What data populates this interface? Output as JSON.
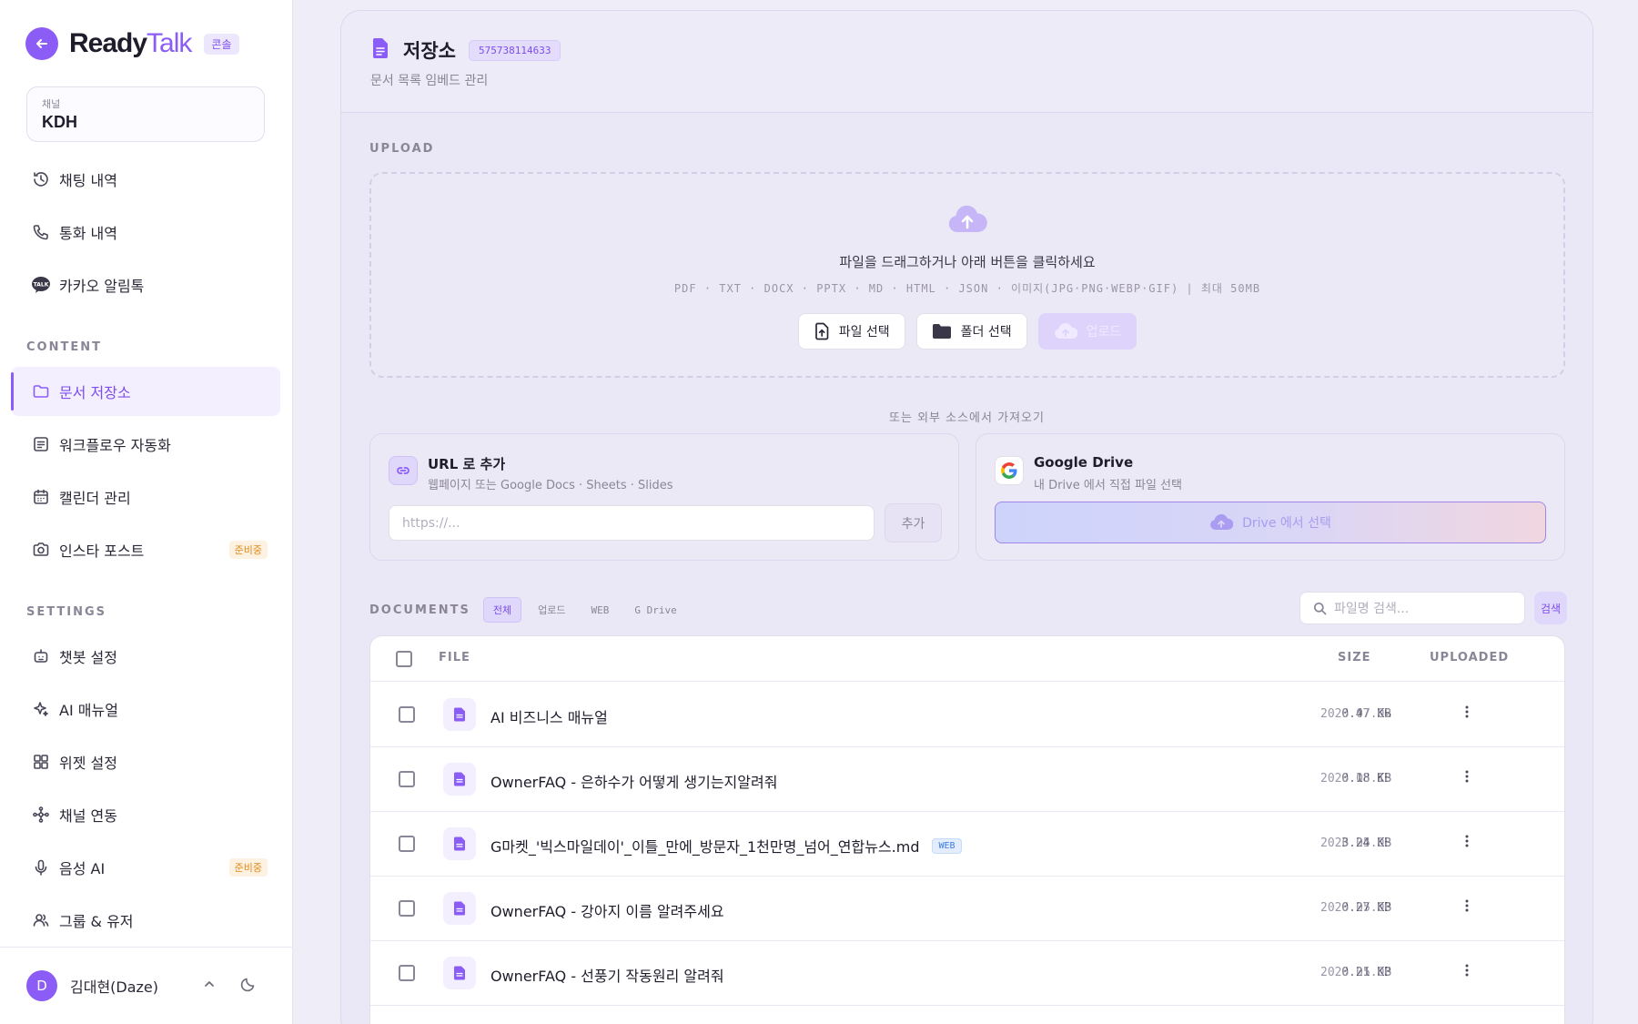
{
  "brand": {
    "logo_part1": "Ready",
    "logo_part2": "Talk",
    "badge": "콘솔"
  },
  "channel": {
    "label": "채널",
    "value": "KDH"
  },
  "nav_top": [
    {
      "label": "채팅 내역",
      "icon": "history-icon"
    },
    {
      "label": "통화 내역",
      "icon": "phone-icon"
    },
    {
      "label": "카카오 알림톡",
      "icon": "kakao-talk-icon"
    }
  ],
  "sections": {
    "content": "CONTENT",
    "settings": "SETTINGS"
  },
  "nav_content": [
    {
      "label": "문서 저장소",
      "icon": "folder-icon",
      "active": true
    },
    {
      "label": "워크플로우 자동화",
      "icon": "workflow-icon"
    },
    {
      "label": "캘린더 관리",
      "icon": "calendar-icon"
    },
    {
      "label": "인스타 포스트",
      "icon": "camera-icon",
      "badge": "준비중"
    }
  ],
  "nav_settings": [
    {
      "label": "챗봇 설정",
      "icon": "bot-icon"
    },
    {
      "label": "AI 매뉴얼",
      "icon": "sparkle-icon"
    },
    {
      "label": "위젯 설정",
      "icon": "grid-icon"
    },
    {
      "label": "채널 연동",
      "icon": "network-icon"
    },
    {
      "label": "음성 AI",
      "icon": "mic-icon",
      "badge": "준비중"
    },
    {
      "label": "그룹 & 유저",
      "icon": "users-icon"
    }
  ],
  "user": {
    "initial": "D",
    "name": "김대현(Daze)"
  },
  "page": {
    "title": "저장소",
    "id": "575738114633",
    "subtitle": "문서 목록 임베드 관리"
  },
  "upload": {
    "label": "UPLOAD",
    "drop_text": "파일을 드래그하거나 아래 버튼을 클릭하세요",
    "formats": "PDF · TXT · DOCX · PPTX · MD · HTML · JSON · 이미지(JPG·PNG·WEBP·GIF) | 최대 50MB",
    "file_button": "파일 선택",
    "folder_button": "폴더 선택",
    "upload_button": "업로드"
  },
  "external": {
    "or_text": "또는 외부 소스에서 가져오기",
    "url_title": "URL 로 추가",
    "url_desc": "웹페이지 또는 Google Docs · Sheets · Slides",
    "url_placeholder": "https://...",
    "url_add": "추가",
    "drive_title": "Google Drive",
    "drive_desc": "내 Drive 에서 직접 파일 선택",
    "drive_button": "Drive 에서 선택"
  },
  "documents": {
    "label": "DOCUMENTS",
    "filters": [
      "전체",
      "업로드",
      "WEB",
      "G Drive"
    ],
    "active_filter": 0,
    "search_placeholder": "파일명 검색...",
    "search_button": "검색",
    "columns": {
      "file": "FILE",
      "size": "SIZE",
      "uploaded": "UPLOADED"
    },
    "rows": [
      {
        "name": "AI 비즈니스 매뉴얼",
        "size": "0.47 KB",
        "uploaded": "2026.07.02",
        "tag": ""
      },
      {
        "name": "OwnerFAQ - 은하수가 어떻게 생기는지알려줘",
        "size": "0.18 KB",
        "uploaded": "2026.05.18",
        "tag": ""
      },
      {
        "name": "G마켓_'빅스마일데이'_이틀_만에_방문자_1천만명_넘어_연합뉴스.md",
        "size": "3.24 KB",
        "uploaded": "2026.05.08",
        "tag": "WEB"
      },
      {
        "name": "OwnerFAQ - 강아지 이름 알려주세요",
        "size": "0.27 KB",
        "uploaded": "2026.05.06",
        "tag": ""
      },
      {
        "name": "OwnerFAQ - 선풍기 작동원리 알려줘",
        "size": "0.21 KB",
        "uploaded": "2026.05.06",
        "tag": ""
      }
    ]
  },
  "colors": {
    "accent": "#8b5cf6",
    "warning": "#e08a1a",
    "web_tag": "#3b7de0"
  }
}
